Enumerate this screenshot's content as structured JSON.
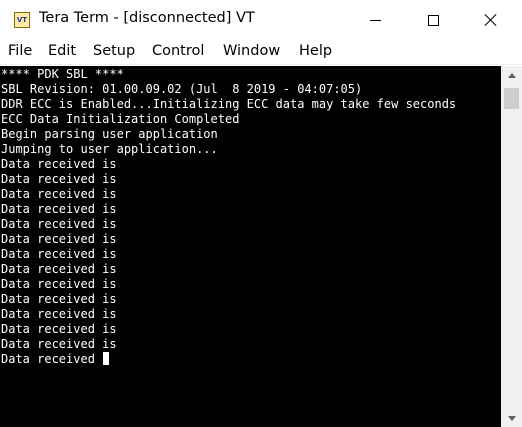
{
  "window": {
    "title": "Tera Term - [disconnected] VT",
    "icon_label": "VT",
    "icon_name": "teraterm-app-icon"
  },
  "menu": {
    "items": [
      "File",
      "Edit",
      "Setup",
      "Control",
      "Window",
      "Help"
    ]
  },
  "terminal": {
    "lines": [
      "**** PDK SBL ****",
      "SBL Revision: 01.00.09.02 (Jul  8 2019 - 04:07:05)",
      "DDR ECC is Enabled...Initializing ECC data may take few seconds",
      "ECC Data Initialization Completed",
      "Begin parsing user application",
      "Jumping to user application...",
      "Data received is",
      "Data received is",
      "Data received is",
      "Data received is",
      "Data received is",
      "Data received is",
      "Data received is",
      "Data received is",
      "Data received is",
      "Data received is",
      "Data received is",
      "Data received is",
      "Data received is",
      "Data received "
    ],
    "background": "#000000",
    "foreground": "#ffffff"
  },
  "scrollbar": {
    "scroll_position": 0
  }
}
